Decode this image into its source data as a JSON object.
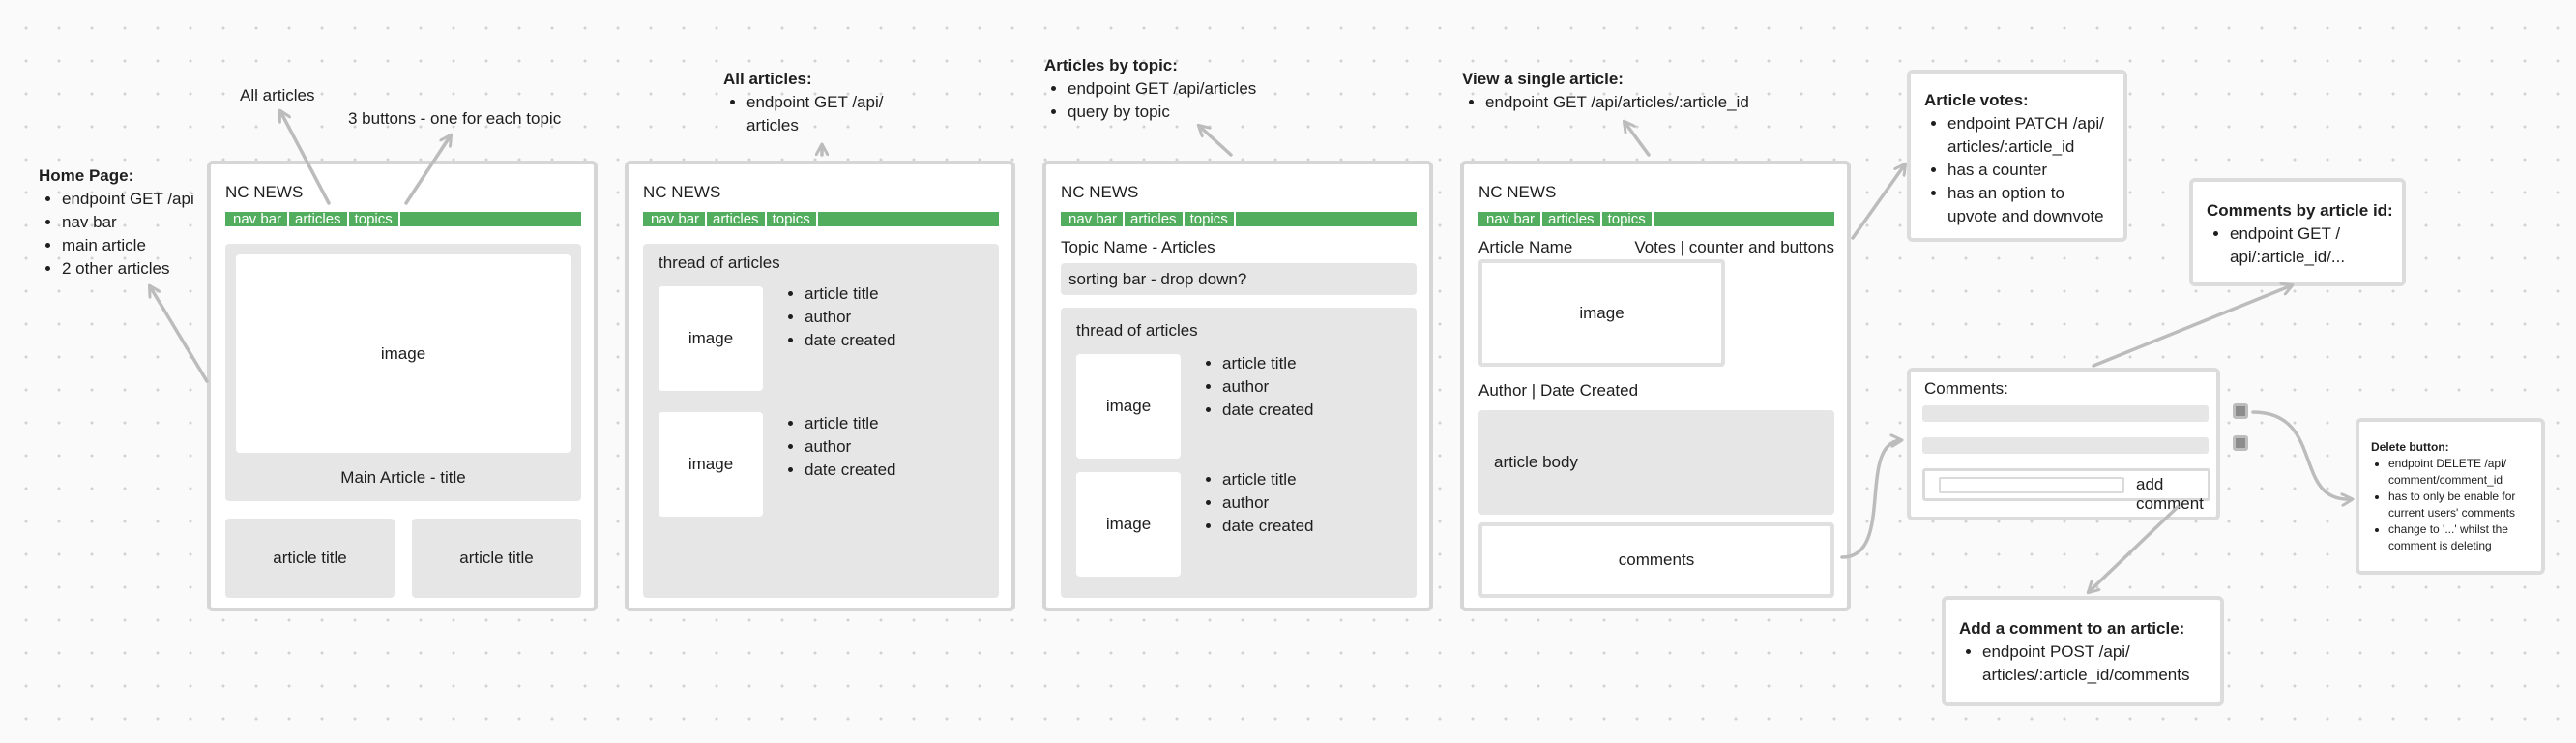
{
  "brand": "NC NEWS",
  "nav": [
    "nav bar",
    "articles",
    "topics"
  ],
  "home": {
    "note_title": "Home Page:",
    "note_items": [
      "endpoint GET /api",
      "nav bar",
      "main article",
      "2 other articles"
    ],
    "label_all_articles": "All articles",
    "label_buttons": "3 buttons - one for each topic",
    "image": "image",
    "main_title": "Main Article - title",
    "card_titles": [
      "article title",
      "article title"
    ]
  },
  "all_articles": {
    "note_title": "All articles:",
    "note_items": [
      "endpoint GET /api/ articles"
    ],
    "thread": "thread of articles",
    "items": [
      {
        "image": "image",
        "fields": [
          "article title",
          "author",
          "date created"
        ]
      },
      {
        "image": "image",
        "fields": [
          "article title",
          "author",
          "date created"
        ]
      }
    ]
  },
  "by_topic": {
    "note_title": "Articles by topic:",
    "note_items": [
      "endpoint GET /api/articles",
      "query by topic"
    ],
    "topic_heading": "Topic Name - Articles",
    "sorting": "sorting bar - drop down?",
    "thread": "thread of articles",
    "items": [
      {
        "image": "image",
        "fields": [
          "article title",
          "author",
          "date created"
        ]
      },
      {
        "image": "image",
        "fields": [
          "article title",
          "author",
          "date created"
        ]
      }
    ]
  },
  "single": {
    "note_title": "View a single article:",
    "note_items": [
      "endpoint GET /api/articles/:article_id"
    ],
    "article_name": "Article Name",
    "votes": "Votes | counter and buttons",
    "image": "image",
    "author_date": "Author | Date Created",
    "body": "article body",
    "comments": "comments"
  },
  "votes_note": {
    "title": "Article votes:",
    "items": [
      "endpoint PATCH /api/ articles/:article_id",
      "has a counter",
      "has an option to upvote and downvote"
    ]
  },
  "comments_by_id": {
    "title": "Comments by article id:",
    "items": [
      "endpoint GET / api/:article_id/..."
    ]
  },
  "comments_panel": {
    "title": "Comments:",
    "add_comment": "add comment"
  },
  "add_comment_note": {
    "title": "Add a comment to an article:",
    "items": [
      "endpoint POST /api/ articles/:article_id/comments"
    ]
  },
  "delete_note": {
    "title": "Delete button:",
    "items": [
      "endpoint DELETE /api/ comment/comment_id",
      "has to only be enable for current users' comments",
      "change to '...' whilst the comment is deleting"
    ]
  },
  "colors": {
    "nav_green": "#52ae5e",
    "frame_grey": "#d6d6d6",
    "panel_grey": "#e6e6e6",
    "arrow_grey": "#bcbcbc"
  }
}
